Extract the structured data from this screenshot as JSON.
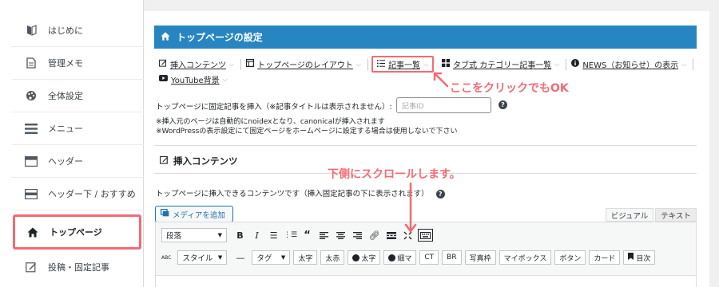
{
  "sidebar": {
    "items": [
      {
        "label": "はじめに",
        "icon": "book-half-icon"
      },
      {
        "label": "管理メモ",
        "icon": "document-icon"
      },
      {
        "label": "全体設定",
        "icon": "palette-icon"
      },
      {
        "label": "メニュー",
        "icon": "menu-icon"
      },
      {
        "label": "ヘッダー",
        "icon": "header-icon"
      },
      {
        "label": "ヘッダー下 / おすすめ",
        "icon": "header-below-icon"
      },
      {
        "label": "トップページ",
        "icon": "home-icon"
      },
      {
        "label": "投稿・固定記事",
        "icon": "edit-icon"
      }
    ],
    "active_index": 6
  },
  "panel": {
    "title": "トップページの設定",
    "tabs": [
      {
        "label": "挿入コンテンツ"
      },
      {
        "label": "トップページのレイアウト"
      },
      {
        "label": "記事一覧"
      },
      {
        "label": "タブ式 カテゴリー記事一覧"
      },
      {
        "label": "NEWS（お知らせ）の表示"
      },
      {
        "label": "YouTube背景"
      }
    ]
  },
  "annotations": {
    "click_hint": "ここをクリックでもOK",
    "scroll_hint": "下側にスクロールします。",
    "color": "#f46a73"
  },
  "fixed_post": {
    "label": "トップページに固定記事を挿入（※記事タイトルは表示されません）:",
    "placeholder": "記事ID",
    "note1": "※挿入元のページは自動的にnoidexとなり、canonicalが挿入されます",
    "note2": "※WordPressの表示設定にて固定ページをホームページに設定する場合は使用しないで下さい"
  },
  "insert_section": {
    "heading": "挿入コンテンツ",
    "description": "トップページに挿入できるコンテンツです（挿入固定記事の下に表示されます）",
    "media_button": "メディアを追加",
    "mode_visual": "ビジュアル",
    "mode_text": "テキスト"
  },
  "editor": {
    "format_select": "段落",
    "style_select": "スタイル",
    "tag_select": "タグ",
    "quicktags": [
      "太字",
      "太赤",
      "太字",
      "細マ",
      "CT",
      "BR",
      "写真枠",
      "マイボックス",
      "ボタン",
      "カード",
      "目次"
    ]
  },
  "colors": {
    "accent": "#2786c2",
    "highlight": "#f46a73"
  }
}
